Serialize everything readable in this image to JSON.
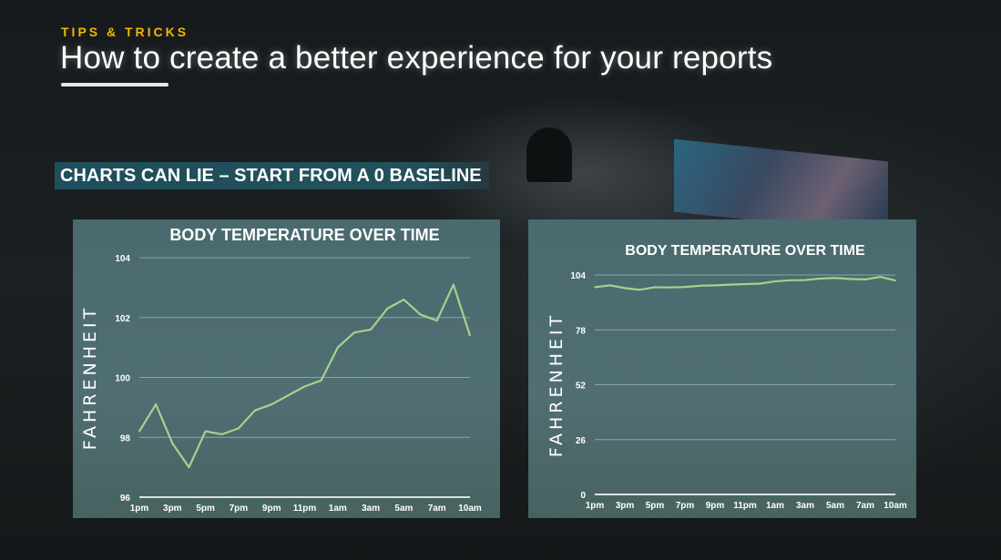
{
  "header": {
    "kicker": "TIPS & TRICKS",
    "title": "How to create a better experience for your reports",
    "subtitle": "CHARTS CAN LIE – START FROM A 0 BASELINE"
  },
  "colors": {
    "accent": "#f2b705",
    "line": "#a8d08d",
    "panel": "#4d6c71",
    "subtitle_bg": "#1f4f5c"
  },
  "chart_data": [
    {
      "type": "line",
      "title": "BODY TEMPERATURE OVER TIME",
      "ylabel": "FAHRENHEIT",
      "xlabel": "",
      "ylim": [
        96,
        104
      ],
      "yticks": [
        "96",
        "98",
        "100",
        "102",
        "104"
      ],
      "grid": true,
      "xtick_labels": [
        "1pm",
        "3pm",
        "5pm",
        "7pm",
        "9pm",
        "11pm",
        "1am",
        "3am",
        "5am",
        "7am",
        "10am"
      ],
      "values": [
        98.2,
        99.1,
        97.8,
        97.0,
        98.2,
        98.1,
        98.3,
        98.9,
        99.1,
        99.4,
        99.7,
        99.9,
        101.0,
        101.5,
        101.6,
        102.3,
        102.6,
        102.1,
        101.9,
        103.1,
        101.4
      ]
    },
    {
      "type": "line",
      "title": "BODY TEMPERATURE OVER TIME",
      "ylabel": "FAHRENHEIT",
      "xlabel": "",
      "ylim": [
        0,
        104
      ],
      "yticks": [
        "0",
        "26",
        "52",
        "78",
        "104"
      ],
      "grid": true,
      "xtick_labels": [
        "1pm",
        "3pm",
        "5pm",
        "7pm",
        "9pm",
        "11pm",
        "1am",
        "3am",
        "5am",
        "7am",
        "10am"
      ],
      "values": [
        98.2,
        99.1,
        97.8,
        97.0,
        98.2,
        98.1,
        98.3,
        98.9,
        99.1,
        99.4,
        99.7,
        99.9,
        101.0,
        101.5,
        101.6,
        102.3,
        102.6,
        102.1,
        101.9,
        103.1,
        101.4
      ]
    }
  ]
}
